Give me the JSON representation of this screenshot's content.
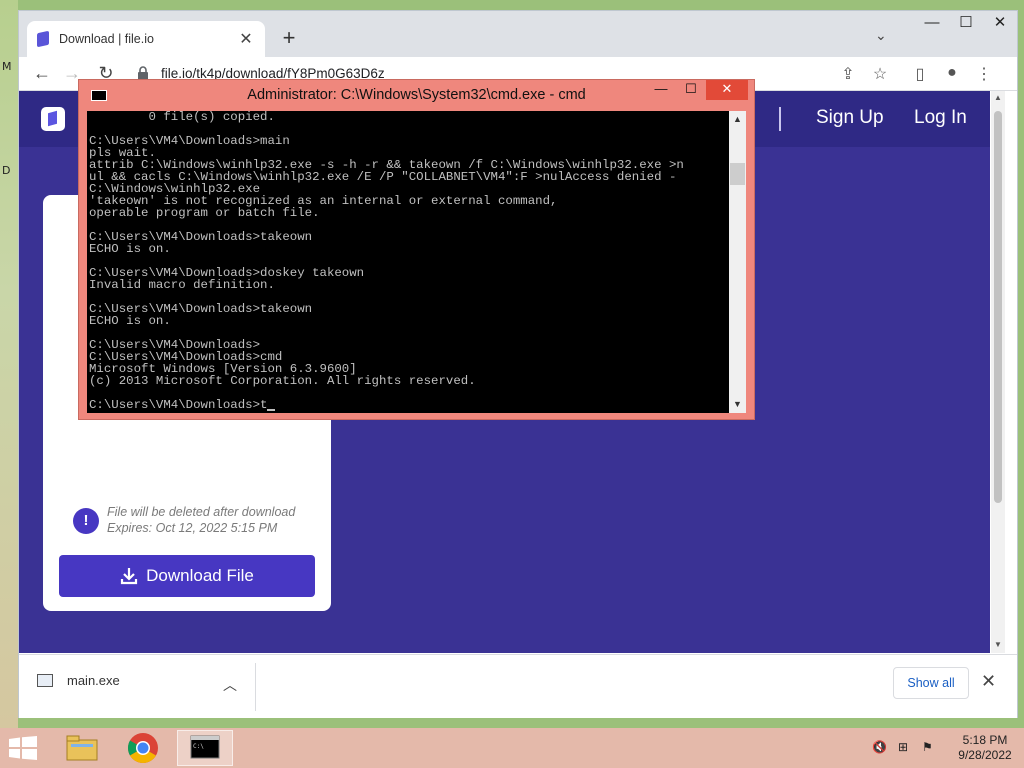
{
  "desktop": {
    "glyph_1": "M",
    "glyph_2": "D"
  },
  "browser": {
    "tab_title": "Download | file.io",
    "tab_close": "✕",
    "new_tab": "+",
    "tab_search": "⌄",
    "window_minimize": "—",
    "window_maximize": "☐",
    "window_close": "✕",
    "url": "file.io/tk4p/download/fY8Pm0G63D6z"
  },
  "site": {
    "nav_signup": "Sign Up",
    "nav_login": "Log In",
    "info_line1": "File will be deleted after download",
    "info_line2": "Expires: Oct 12, 2022 5:15 PM",
    "info_icon": "!",
    "download_button": "Download File"
  },
  "download_shelf": {
    "file_name": "main.exe",
    "show_all": "Show all",
    "close": "✕"
  },
  "cmd": {
    "title": "Administrator: C:\\Windows\\System32\\cmd.exe - cmd",
    "lines": [
      "        0 file(s) copied.",
      "",
      "C:\\Users\\VM4\\Downloads>main",
      "pls wait.",
      "attrib C:\\Windows\\winhlp32.exe -s -h -r && takeown /f C:\\Windows\\winhlp32.exe >n",
      "ul && cacls C:\\Windows\\winhlp32.exe /E /P \"COLLABNET\\VM4\":F >nulAccess denied -",
      "C:\\Windows\\winhlp32.exe",
      "'takeown' is not recognized as an internal or external command,",
      "operable program or batch file.",
      "",
      "C:\\Users\\VM4\\Downloads>takeown",
      "ECHO is on.",
      "",
      "C:\\Users\\VM4\\Downloads>doskey takeown",
      "Invalid macro definition.",
      "",
      "C:\\Users\\VM4\\Downloads>takeown",
      "ECHO is on.",
      "",
      "C:\\Users\\VM4\\Downloads>",
      "C:\\Users\\VM4\\Downloads>cmd",
      "Microsoft Windows [Version 6.3.9600]",
      "(c) 2013 Microsoft Corporation. All rights reserved.",
      "",
      "C:\\Users\\VM4\\Downloads>t"
    ]
  },
  "taskbar": {
    "time": "5:18 PM",
    "date": "9/28/2022"
  },
  "colors": {
    "page_bg": "#3a3294",
    "button": "#4737c2",
    "cmd_frame": "#ef877d",
    "taskbar": "#e4b9aa"
  }
}
